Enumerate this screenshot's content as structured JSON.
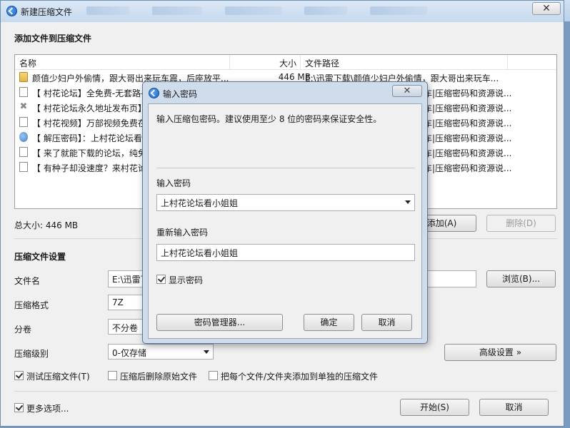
{
  "window": {
    "title": "新建压缩文件",
    "close_glyph": "✕"
  },
  "taskbar_items": [
    "",
    "",
    "",
    "",
    "",
    ""
  ],
  "files_section": {
    "title": "添加文件到压缩文件",
    "columns": {
      "name": "名称",
      "size": "大小",
      "path": "文件路径"
    },
    "rows": [
      {
        "icon": "folder-icon",
        "name": "颜值少妇户外偷情，跟大哥出来玩车震，后座放平...",
        "size": "446 MB",
        "path": "E:\\迅雷下载\\颜值少妇户外偷情，跟大哥出来玩车..."
      },
      {
        "icon": "document-icon",
        "name": "【 村花论坛】全免费-无套路-",
        "size": "",
        "path": "车|压缩密码和资源说..."
      },
      {
        "icon": "x-icon",
        "name": "【 村花论坛永久地址发布页】",
        "size": "",
        "path": "车|压缩密码和资源说..."
      },
      {
        "icon": "document-icon",
        "name": "【 村花视频】万部视频免费在",
        "size": "",
        "path": "车|压缩密码和资源说..."
      },
      {
        "icon": "image-icon",
        "name": "【 解压密码】：上村花论坛看",
        "size": "",
        "path": "车|压缩密码和资源说..."
      },
      {
        "icon": "document-icon",
        "name": "【 来了就能下载的论坛，纯免",
        "size": "",
        "path": "车|压缩密码和资源说..."
      },
      {
        "icon": "document-icon",
        "name": "【 有种子却没速度？来村花论",
        "size": "",
        "path": "车|压缩密码和资源说..."
      }
    ],
    "total_size": "总大小: 446 MB",
    "add_button": "添加(A)",
    "delete_button": "删除(D)"
  },
  "settings": {
    "title": "压缩文件设置",
    "filename_label": "文件名",
    "filename_value": "E:\\迅雷下",
    "browse_button": "浏览(B)...",
    "format_label": "压缩格式",
    "format_value": "7Z",
    "split_label": "分卷",
    "split_value": "不分卷",
    "level_label": "压缩级别",
    "level_value": "0-仅存储",
    "advanced_button": "高级设置 »",
    "test_checkbox": "测试压缩文件(T)",
    "delete_after_checkbox": "压缩后删除原始文件",
    "separate_checkbox": "把每个文件/文件夹添加到单独的压缩文件",
    "more_options_checkbox": "更多选项...",
    "start_button": "开始(S)",
    "cancel_button": "取消"
  },
  "password_dialog": {
    "title": "输入密码",
    "close_glyph": "✕",
    "description": "输入压缩包密码。建议使用至少 8 位的密码来保证安全性。",
    "password_label": "输入密码",
    "password_value": "上村花论坛看小姐姐",
    "confirm_label": "重新输入密码",
    "confirm_value": "上村花论坛看小姐姐",
    "show_password": "显示密码",
    "manager_button": "密码管理器...",
    "ok_button": "确定",
    "cancel_button": "取消"
  },
  "colors": {
    "dialog_frame": "#cfdcec",
    "window_bg": "#f0f0f0"
  }
}
